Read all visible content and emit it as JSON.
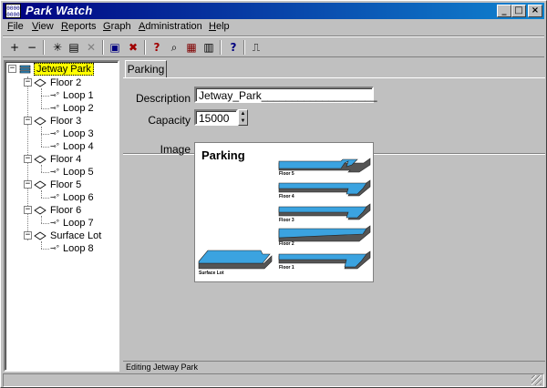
{
  "window": {
    "title": "Park Watch",
    "icon_text": "0000\n0000",
    "controls": {
      "minimize": "_",
      "maximize": "□",
      "close": "×"
    }
  },
  "menu": [
    {
      "label": "File",
      "u": "F",
      "rest": "ile"
    },
    {
      "label": "View",
      "u": "V",
      "rest": "iew"
    },
    {
      "label": "Reports",
      "u": "R",
      "rest": "eports"
    },
    {
      "label": "Graph",
      "u": "G",
      "rest": "raph"
    },
    {
      "label": "Administration",
      "u": "A",
      "rest": "dministration"
    },
    {
      "label": "Help",
      "u": "H",
      "rest": "elp"
    }
  ],
  "toolbar": [
    {
      "name": "add-icon",
      "glyph": "+"
    },
    {
      "name": "remove-icon",
      "glyph": "−"
    },
    {
      "name": "new-item-icon",
      "glyph": "✳"
    },
    {
      "name": "properties-icon",
      "glyph": "▤"
    },
    {
      "name": "delete-icon",
      "glyph": "✕"
    },
    {
      "name": "save-icon",
      "glyph": "▣"
    },
    {
      "name": "cancel-icon",
      "glyph": "✖"
    },
    {
      "name": "find-help-icon",
      "glyph": "?"
    },
    {
      "name": "search-icon",
      "glyph": "⌕"
    },
    {
      "name": "graph-icon",
      "glyph": "▦"
    },
    {
      "name": "report-icon",
      "glyph": "▥"
    },
    {
      "name": "help-icon",
      "glyph": "?"
    },
    {
      "name": "exit-icon",
      "glyph": "⎍"
    }
  ],
  "tree": {
    "root": "Jetway Park",
    "floors": [
      {
        "label": "Floor 2",
        "loops": [
          "Loop 1",
          "Loop 2"
        ]
      },
      {
        "label": "Floor 3",
        "loops": [
          "Loop 3",
          "Loop 4"
        ]
      },
      {
        "label": "Floor 4",
        "loops": [
          "Loop 5"
        ]
      },
      {
        "label": "Floor 5",
        "loops": [
          "Loop 6"
        ]
      },
      {
        "label": "Floor 6",
        "loops": [
          "Loop 7"
        ]
      },
      {
        "label": "Surface Lot",
        "loops": [
          "Loop 8"
        ]
      }
    ],
    "expand_glyph": "−"
  },
  "tab": {
    "label": "Parking"
  },
  "form": {
    "description_label": "Description",
    "description_value": "Jetway_Park___________________",
    "capacity_label": "Capacity",
    "capacity_value": "15000",
    "image_label": "Image"
  },
  "image": {
    "title": "Parking",
    "labels": {
      "floor5": "Floor 5",
      "floor4": "Floor 4",
      "floor3": "Floor 3",
      "floor2": "Floor 2",
      "floor1": "Floor 1",
      "surface": "Surface Lot"
    },
    "colors": {
      "deck": "#3ba3e0",
      "side": "#555555",
      "edge": "#222222"
    }
  },
  "status": {
    "editing": "Editing Jetway Park"
  }
}
